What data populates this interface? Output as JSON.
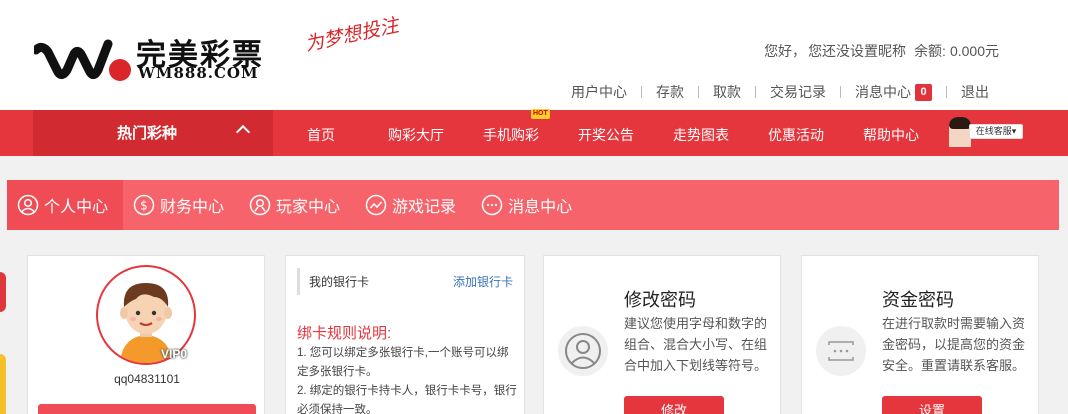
{
  "brand": {
    "logo_cn": "完美彩票",
    "logo_en": "WM888.COM",
    "slogan": "为梦想投注"
  },
  "header": {
    "greeting": "您好，",
    "nickname_text": "您还没设置昵称",
    "balance_label": "余额:",
    "balance_value": "0.000元",
    "links": [
      "用户中心",
      "存款",
      "取款",
      "交易记录",
      "消息中心",
      "退出"
    ],
    "message_count": "0"
  },
  "nav": {
    "hot_category": "热门彩种",
    "items": [
      "首页",
      "购彩大厅",
      "手机购彩",
      "开奖公告",
      "走势图表",
      "优惠活动",
      "帮助中心"
    ],
    "hot_tag": "HOT",
    "customer_service": "在线客服▾"
  },
  "tabs": [
    "个人中心",
    "财务中心",
    "玩家中心",
    "游戏记录",
    "消息中心"
  ],
  "profile": {
    "vip_level": "VIP0",
    "username": "qq04831101"
  },
  "bank": {
    "title": "我的银行卡",
    "add_link": "添加银行卡",
    "rules_title": "绑卡规则说明:",
    "rules": [
      "1. 您可以绑定多张银行卡,一个账号可以绑定多张银行卡。",
      "2. 绑定的银行卡持卡人，银行卡卡号，银行必须保持一致。"
    ]
  },
  "cards": [
    {
      "title": "修改密码",
      "desc": "建议您使用字母和数字的组合、混合大小写、在组合中加入下划线等符号。",
      "button": "修改",
      "icon": "user-icon"
    },
    {
      "title": "资金密码",
      "desc": "在进行取款时需要输入资金密码，以提高您的资金安全。重置请联系客服。",
      "button": "设置",
      "icon": "password-dots-icon"
    }
  ],
  "colors": {
    "primary_red": "#e5363d",
    "tab_bar": "#f7636b",
    "link_blue": "#3a73b9"
  }
}
